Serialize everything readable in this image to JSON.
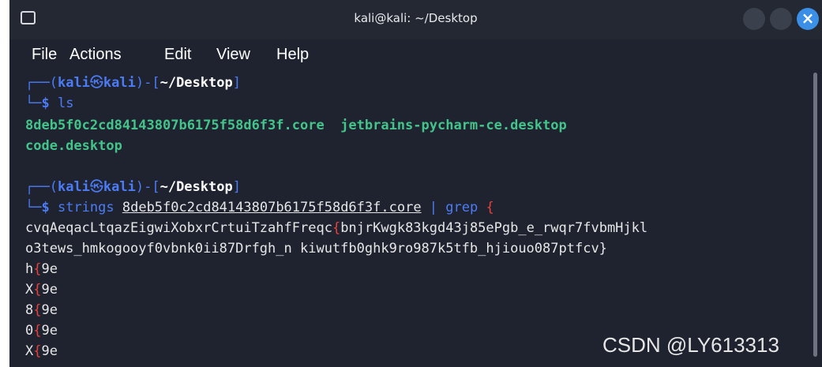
{
  "window": {
    "title": "kali@kali: ~/Desktop",
    "close_glyph": "×"
  },
  "menu": [
    "File",
    "Actions",
    "Edit",
    "View",
    "Help"
  ],
  "prompt": {
    "corner_top": "┌──",
    "corner_bottom": "└─",
    "open": "(",
    "user": "kali",
    "at": "㉿",
    "host": "kali",
    "close": ")-[",
    "path": "~/Desktop",
    "end": "]",
    "dollar": "$"
  },
  "block1": {
    "command": " ls",
    "output_line1": "8deb5f0c2cd84143807b6175f58d6f3f.core  jetbrains-pycharm-ce.desktop",
    "output_line2": "code.desktop"
  },
  "block2": {
    "cmd_strings": " strings ",
    "cmd_file": "8deb5f0c2cd84143807b6175f58d6f3f.core",
    "cmd_pipe": " | ",
    "cmd_grep": "grep ",
    "cmd_brace": "{",
    "out1_a": "cvqAeqacLtqazEigwiXobxrCrtuiTzahfFreqc",
    "out1_brace": "{",
    "out1_b": "bnjrKwgk83kgd43j85ePgb_e_rwqr7fvbmHjkl",
    "out2": "o3tews_hmkogooyf0vbnk0ii87Drfgh_n kiwutfb0ghk9ro987k5tfb_hjiouo087ptfcv}",
    "matches": [
      {
        "pre": "h",
        "brace": "{",
        "post": "9e"
      },
      {
        "pre": "X",
        "brace": "{",
        "post": "9e"
      },
      {
        "pre": "8",
        "brace": "{",
        "post": "9e"
      },
      {
        "pre": "0",
        "brace": "{",
        "post": "9e"
      },
      {
        "pre": "X",
        "brace": "{",
        "post": "9e"
      }
    ]
  },
  "watermark": "CSDN @LY613313",
  "colors": {
    "background": "#1f2330",
    "prompt_blue": "#4c7cf5",
    "output_green": "#43c48a",
    "match_red": "#e8403a",
    "close_button": "#3b8fe6"
  }
}
